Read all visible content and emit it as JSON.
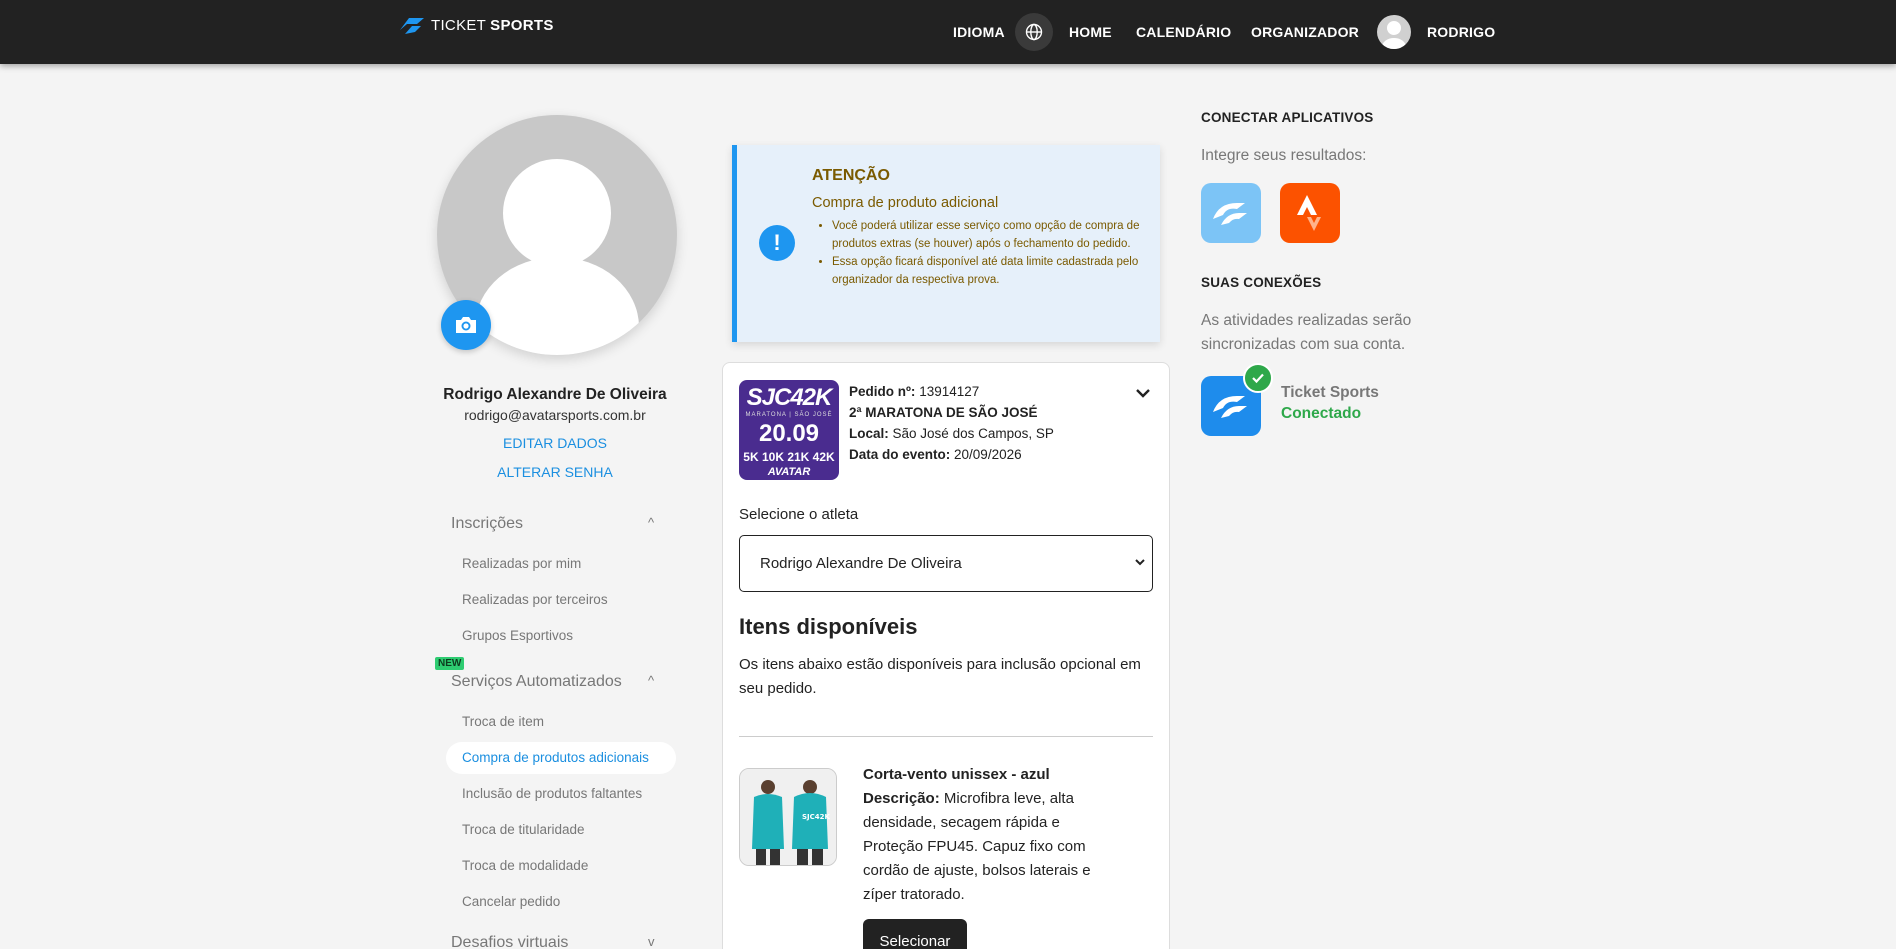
{
  "header": {
    "logo_prefix": "TICKET",
    "logo_suffix": "SPORTS",
    "nav": {
      "idioma": "IDIOMA",
      "home": "HOME",
      "calendario": "CALENDÁRIO",
      "organizador": "ORGANIZADOR",
      "user": "RODRIGO"
    }
  },
  "profile": {
    "name": "Rodrigo Alexandre De Oliveira",
    "email": "rodrigo@avatarsports.com.br",
    "edit_label": "EDITAR DADOS",
    "password_label": "ALTERAR SENHA"
  },
  "menu": {
    "inscricoes": "Inscrições",
    "inscricoes_items": [
      "Realizadas por mim",
      "Realizadas por terceiros",
      "Grupos Esportivos"
    ],
    "new_badge": "NEW",
    "servicos": "Serviços Automatizados",
    "servicos_items": [
      "Troca de item",
      "Compra de produtos adicionais",
      "Inclusão de produtos faltantes",
      "Troca de titularidade",
      "Troca de modalidade",
      "Cancelar pedido"
    ],
    "desafios": "Desafios virtuais",
    "caret_up": "^",
    "caret_down": "v"
  },
  "alert": {
    "title": "ATENÇÃO",
    "subtitle": "Compra de produto adicional",
    "bullets": [
      "Você poderá utilizar esse serviço como opção de compra de produtos extras (se houver) após o fechamento do pedido.",
      "Essa opção ficará disponível até data limite cadastrada pelo organizador da respectiva prova."
    ]
  },
  "order": {
    "logo": {
      "l1": "SJC42K",
      "l2": "MARATONA | SÃO JOSÉ",
      "l3": "20.09",
      "l4": "5K 10K 21K 42K",
      "l5": "AVATAR"
    },
    "number_label": "Pedido nº:",
    "number": "13914127",
    "event_name": "2ª MARATONA DE SÃO JOSÉ",
    "local_label": "Local:",
    "local": "São José dos Campos, SP",
    "date_label": "Data do evento:",
    "date": "20/09/2026",
    "select_label": "Selecione o atleta",
    "selected_athlete": "Rodrigo Alexandre De Oliveira",
    "items_title": "Itens disponíveis",
    "items_desc": "Os itens abaixo estão disponíveis para inclusão opcional em seu pedido.",
    "product": {
      "name": "Corta-vento unissex - azul",
      "desc_label": "Descrição:",
      "desc": "Microfibra leve, alta densidade, secagem rápida e Proteção FPU45. Capuz fixo com cordão de ajuste, bolsos laterais e zíper tratorado.",
      "button": "Selecionar"
    }
  },
  "apps": {
    "connect_title": "CONECTAR APLICATIVOS",
    "connect_text": "Integre seus resultados:",
    "connections_title": "SUAS CONEXÕES",
    "connections_text": "As atividades realizadas serão sincronizadas com sua conta.",
    "conn_name": "Ticket Sports",
    "conn_status": "Conectado"
  },
  "colors": {
    "accent": "#1e96f0",
    "header": "#222222",
    "success": "#2ea84a",
    "strava": "#fc5200"
  }
}
